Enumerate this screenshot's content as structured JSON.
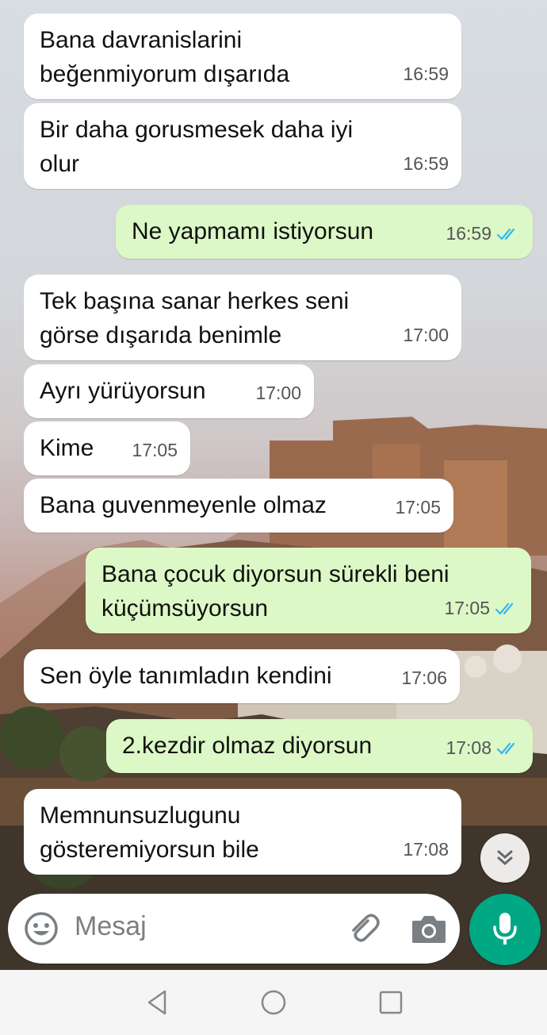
{
  "messages": [
    {
      "dir": "in",
      "text": "Bana davranislarini\nbeğenmiyorum dışarıda",
      "time": "16:59"
    },
    {
      "dir": "in",
      "text": "Bir daha gorusmesek daha iyi\nolur",
      "time": "16:59"
    },
    {
      "dir": "out",
      "text": "Ne yapmamı istiyorsun",
      "time": "16:59",
      "status": "read"
    },
    {
      "dir": "in",
      "text": "Tek başına sanar herkes seni\ngörse dışarıda benimle",
      "time": "17:00"
    },
    {
      "dir": "in",
      "text": "Ayrı yürüyorsun",
      "time": "17:00"
    },
    {
      "dir": "in",
      "text": "Kime",
      "time": "17:05"
    },
    {
      "dir": "in",
      "text": "Bana guvenmeyenle olmaz",
      "time": "17:05"
    },
    {
      "dir": "out",
      "text": "Bana çocuk diyorsun sürekli beni\nküçümsüyorsun",
      "time": "17:05",
      "status": "read"
    },
    {
      "dir": "in",
      "text": "Sen öyle tanımladın kendini",
      "time": "17:06"
    },
    {
      "dir": "out",
      "text": "2.kezdir olmaz diyorsun",
      "time": "17:08",
      "status": "read"
    },
    {
      "dir": "in",
      "text": "Memnunsuzlugunu\ngösteremiyorsun bile",
      "time": "17:08"
    }
  ],
  "input": {
    "placeholder": "Mesaj"
  },
  "icons": {
    "emoji": "emoji-icon",
    "attach": "paperclip-icon",
    "camera": "camera-icon",
    "mic": "microphone-icon",
    "scroll": "double-chevron-down-icon",
    "back": "nav-back-icon",
    "home": "nav-home-icon",
    "recents": "nav-recents-icon"
  },
  "colors": {
    "incoming": "#ffffff",
    "outgoing": "#dcf8c6",
    "accent": "#00a884",
    "read_tick": "#34b7f1"
  }
}
